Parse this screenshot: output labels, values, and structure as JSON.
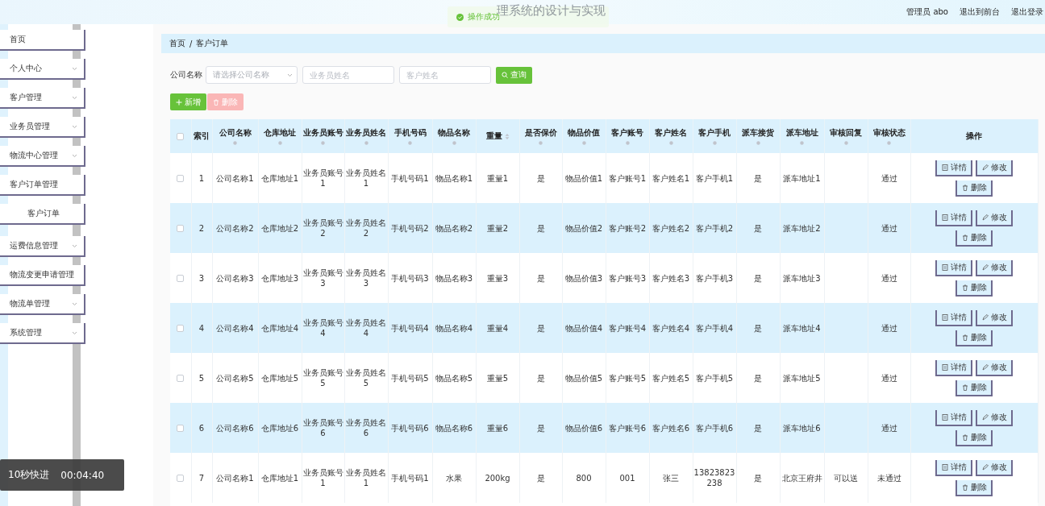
{
  "header": {
    "title": "理系统的设计与实现",
    "user": "管理员 abo",
    "links": [
      "退出到前台",
      "退出登录"
    ]
  },
  "toast": {
    "text": "操作成功"
  },
  "sidebar": {
    "items": [
      {
        "label": "首页"
      },
      {
        "label": "个人中心",
        "expanded": false
      },
      {
        "label": "客户管理",
        "expanded": false
      },
      {
        "label": "业务员管理",
        "expanded": false
      },
      {
        "label": "物流中心管理",
        "expanded": false
      },
      {
        "label": "客户订单管理",
        "expanded": true,
        "children": [
          {
            "label": "客户订单"
          }
        ]
      },
      {
        "label": "运费信息管理",
        "expanded": false
      },
      {
        "label": "物流变更申请管理"
      },
      {
        "label": "物流单管理",
        "expanded": false
      },
      {
        "label": "系统管理",
        "expanded": false
      }
    ]
  },
  "breadcrumb": {
    "items": [
      "首页",
      "客户订单"
    ],
    "separator": "/"
  },
  "search": {
    "label": "公司名称",
    "select_placeholder": "请选择公司名称",
    "fields": [
      {
        "placeholder": "业务员姓名"
      },
      {
        "placeholder": "客户姓名"
      }
    ],
    "button": "查询"
  },
  "actions": [
    {
      "label": "新增",
      "kind": "add",
      "disabled": false
    },
    {
      "label": "删除",
      "kind": "delete",
      "disabled": true
    }
  ],
  "table": {
    "all_checked": false,
    "columns": [
      {
        "label": "索引",
        "kind": "plain"
      },
      {
        "label": "公司名称",
        "kind": "sortable"
      },
      {
        "label": "仓库地址",
        "kind": "sortable"
      },
      {
        "label": "业务员账号",
        "kind": "sortable"
      },
      {
        "label": "业务员姓名",
        "kind": "sortable"
      },
      {
        "label": "手机号码",
        "kind": "sortable"
      },
      {
        "label": "物品名称",
        "kind": "sortable"
      },
      {
        "label": "重量",
        "kind": "sorter"
      },
      {
        "label": "是否保价",
        "kind": "sortable"
      },
      {
        "label": "物品价值",
        "kind": "sortable"
      },
      {
        "label": "客户账号",
        "kind": "sortable"
      },
      {
        "label": "客户姓名",
        "kind": "sortable"
      },
      {
        "label": "客户手机",
        "kind": "sortable"
      },
      {
        "label": "派车接货",
        "kind": "sortable"
      },
      {
        "label": "派车地址",
        "kind": "sortable"
      },
      {
        "label": "审核回复",
        "kind": "sortable"
      },
      {
        "label": "审核状态",
        "kind": "sortable"
      },
      {
        "label": "操作",
        "kind": "plain"
      }
    ],
    "rows": [
      {
        "checked": false,
        "cells": [
          "1",
          "公司名称1",
          "仓库地址1",
          "业务员账号1",
          "业务员姓名1",
          "手机号码1",
          "物品名称1",
          "重量1",
          "是",
          "物品价值1",
          "客户账号1",
          "客户姓名1",
          "客户手机1",
          "是",
          "派车地址1",
          "",
          "通过"
        ],
        "actions": [
          "详情",
          "修改",
          "删除"
        ]
      },
      {
        "checked": false,
        "cells": [
          "2",
          "公司名称2",
          "仓库地址2",
          "业务员账号2",
          "业务员姓名2",
          "手机号码2",
          "物品名称2",
          "重量2",
          "是",
          "物品价值2",
          "客户账号2",
          "客户姓名2",
          "客户手机2",
          "是",
          "派车地址2",
          "",
          "通过"
        ],
        "actions": [
          "详情",
          "修改",
          "删除"
        ]
      },
      {
        "checked": false,
        "cells": [
          "3",
          "公司名称3",
          "仓库地址3",
          "业务员账号3",
          "业务员姓名3",
          "手机号码3",
          "物品名称3",
          "重量3",
          "是",
          "物品价值3",
          "客户账号3",
          "客户姓名3",
          "客户手机3",
          "是",
          "派车地址3",
          "",
          "通过"
        ],
        "actions": [
          "详情",
          "修改",
          "删除"
        ]
      },
      {
        "checked": false,
        "cells": [
          "4",
          "公司名称4",
          "仓库地址4",
          "业务员账号4",
          "业务员姓名4",
          "手机号码4",
          "物品名称4",
          "重量4",
          "是",
          "物品价值4",
          "客户账号4",
          "客户姓名4",
          "客户手机4",
          "是",
          "派车地址4",
          "",
          "通过"
        ],
        "actions": [
          "详情",
          "修改",
          "删除"
        ]
      },
      {
        "checked": false,
        "cells": [
          "5",
          "公司名称5",
          "仓库地址5",
          "业务员账号5",
          "业务员姓名5",
          "手机号码5",
          "物品名称5",
          "重量5",
          "是",
          "物品价值5",
          "客户账号5",
          "客户姓名5",
          "客户手机5",
          "是",
          "派车地址5",
          "",
          "通过"
        ],
        "actions": [
          "详情",
          "修改",
          "删除"
        ]
      },
      {
        "checked": false,
        "cells": [
          "6",
          "公司名称6",
          "仓库地址6",
          "业务员账号6",
          "业务员姓名6",
          "手机号码6",
          "物品名称6",
          "重量6",
          "是",
          "物品价值6",
          "客户账号6",
          "客户姓名6",
          "客户手机6",
          "是",
          "派车地址6",
          "",
          "通过"
        ],
        "actions": [
          "详情",
          "修改",
          "删除"
        ]
      },
      {
        "checked": false,
        "cells": [
          "7",
          "公司名称1",
          "仓库地址1",
          "业务员账号1",
          "业务员姓名1",
          "手机号码1",
          "水果",
          "200kg",
          "是",
          "800",
          "001",
          "张三",
          "13823823238",
          "是",
          "北京王府井",
          "可以送",
          "未通过"
        ],
        "actions": [
          "详情",
          "修改",
          "删除"
        ]
      }
    ]
  },
  "video_overlay": {
    "label": "10秒快进",
    "time": "00:04:40"
  }
}
